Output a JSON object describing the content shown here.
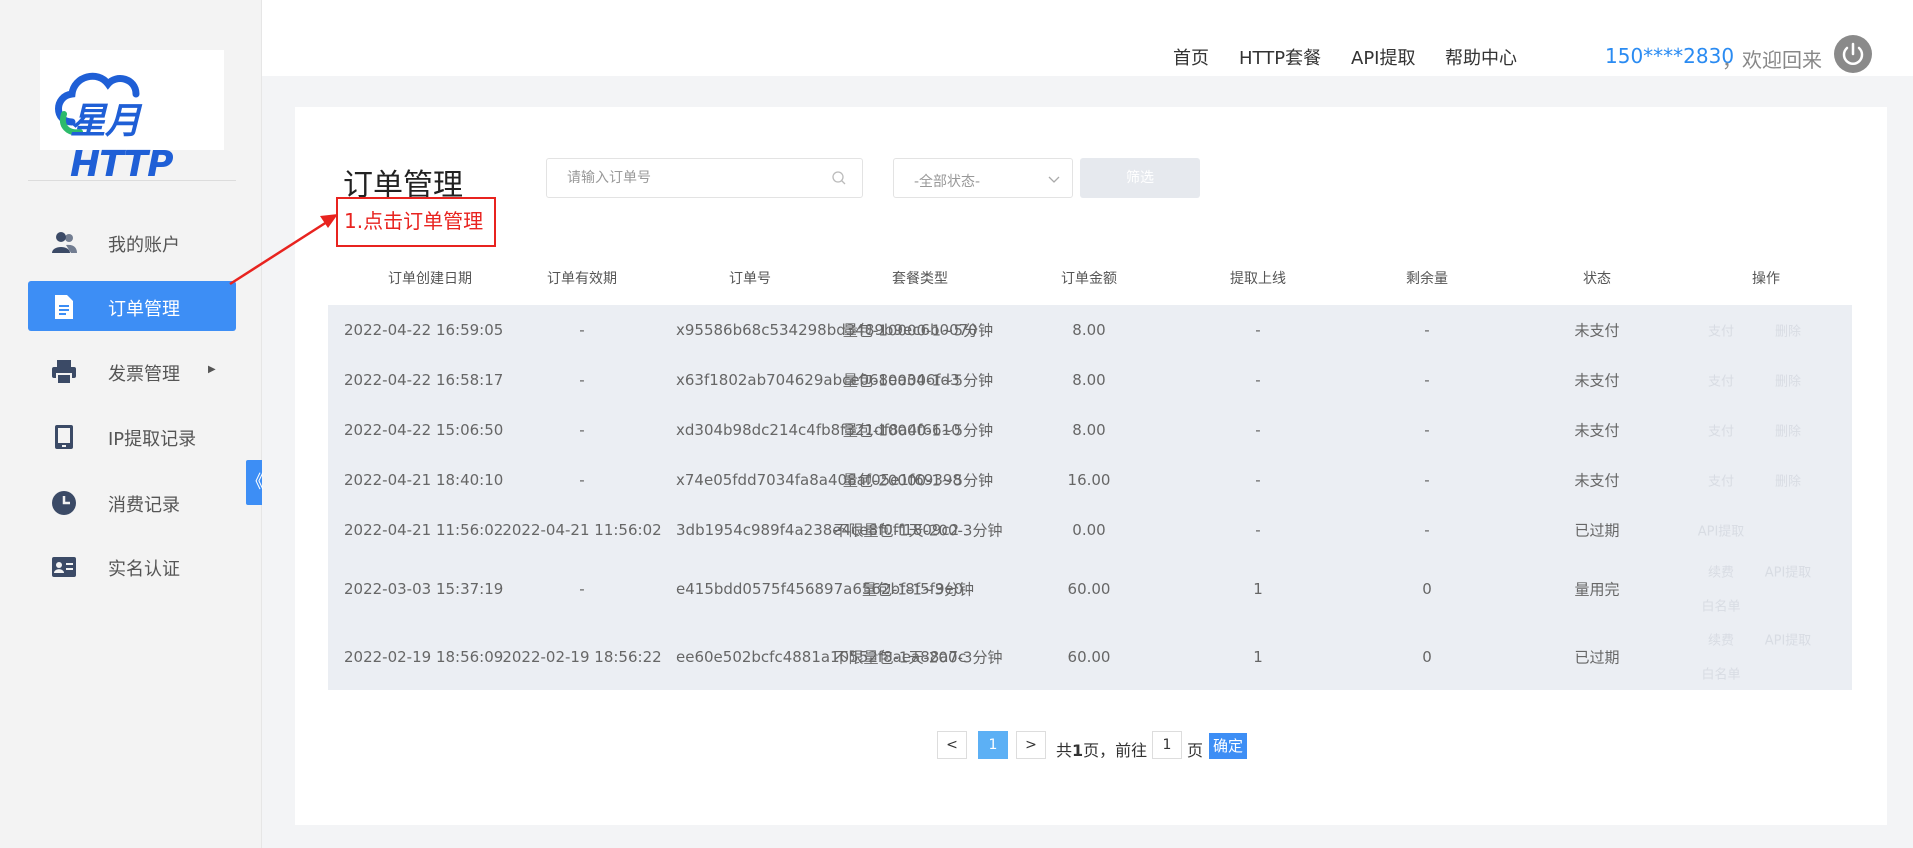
{
  "sidebar": {
    "logo_text": "星月HTTP",
    "items": [
      {
        "label": "我的账户",
        "icon": "users-icon"
      },
      {
        "label": "订单管理",
        "icon": "document-icon",
        "active": true
      },
      {
        "label": "发票管理",
        "icon": "printer-icon",
        "has_caret": true
      },
      {
        "label": "IP提取记录",
        "icon": "tablet-icon"
      },
      {
        "label": "消费记录",
        "icon": "clock-icon"
      },
      {
        "label": "实名认证",
        "icon": "id-card-icon"
      }
    ],
    "collapse_glyph": "《"
  },
  "topbar": {
    "nav": [
      "首页",
      "HTTP套餐",
      "API提取",
      "帮助中心"
    ],
    "user_phone": "150****2830",
    "welcome": "，欢迎回来"
  },
  "page": {
    "title": "订单管理",
    "annotation": "1.点击订单管理",
    "search_placeholder": "请输入订单号",
    "status_select": "-全部状态-",
    "filter_button": "筛选"
  },
  "table": {
    "columns": [
      "订单创建日期",
      "订单有效期",
      "订单号",
      "套餐类型",
      "订单金额",
      "提取上线",
      "剩余量",
      "状态",
      "操作"
    ],
    "rows": [
      {
        "created": "2022-04-22 16:59:05",
        "expires": "-",
        "order_no": "x95586b68c534298bd3489b9ec6b0070",
        "plan": "量包-10000-1~5分钟",
        "amount": "8.00",
        "limit": "-",
        "remaining": "-",
        "status": "未支付",
        "ops": [
          "支付",
          "删除"
        ]
      },
      {
        "created": "2022-04-22 16:58:17",
        "expires": "-",
        "order_no": "x63f1802ab704629abce068ea346fd3",
        "plan": "量包-10000-1~5分钟",
        "amount": "8.00",
        "limit": "-",
        "remaining": "-",
        "status": "未支付",
        "ops": [
          "支付",
          "删除"
        ]
      },
      {
        "created": "2022-04-22 15:06:50",
        "expires": "-",
        "order_no": "xd304b98dc214c4fb8f321df8a4f6610",
        "plan": "量包-10000-1~5分钟",
        "amount": "8.00",
        "limit": "-",
        "remaining": "-",
        "status": "未支付",
        "ops": [
          "支付",
          "删除"
        ]
      },
      {
        "created": "2022-04-21 18:40:10",
        "expires": "-",
        "order_no": "x74e05fdd7034fa8a408af05e1f69398",
        "plan": "量包-20000-1~5分钟",
        "amount": "16.00",
        "limit": "-",
        "remaining": "-",
        "status": "未支付",
        "ops": [
          "支付",
          "删除"
        ]
      },
      {
        "created": "2022-04-21 11:56:02",
        "expires": "2022-04-21 11:56:02",
        "order_no": "3db1954c989f4a238e4ce8f0ff1809c2",
        "plan": "不限量包-1天-200-3分钟",
        "amount": "0.00",
        "limit": "-",
        "remaining": "-",
        "status": "已过期",
        "ops": [
          "API提取"
        ]
      },
      {
        "created": "2022-03-03 15:37:19",
        "expires": "-",
        "order_no": "e415bdd0575f456897a6562bf8f5f9e0",
        "plan": "量包-1-1~3分钟",
        "amount": "60.00",
        "limit": "1",
        "remaining": "0",
        "status": "量用完",
        "ops": [
          "续费",
          "API提取",
          "白名单"
        ]
      },
      {
        "created": "2022-02-19 18:56:09",
        "expires": "2022-02-19 18:56:22",
        "order_no": "ee60e502bcfc4881a10552f8aea88a7c",
        "plan": "不限量包-1天-200-3分钟",
        "amount": "60.00",
        "limit": "1",
        "remaining": "0",
        "status": "已过期",
        "ops": [
          "续费",
          "API提取",
          "白名单"
        ]
      }
    ]
  },
  "pagination": {
    "prev": "<",
    "current": "1",
    "next": ">",
    "total_text_pre": "共",
    "total_pages": "1",
    "total_text_post": "页，前往",
    "goto_value": "1",
    "page_unit": "页",
    "confirm": "确定"
  },
  "colors": {
    "accent": "#3d8ef5",
    "annotation": "#e8231f",
    "phone": "#2a8bf2"
  }
}
